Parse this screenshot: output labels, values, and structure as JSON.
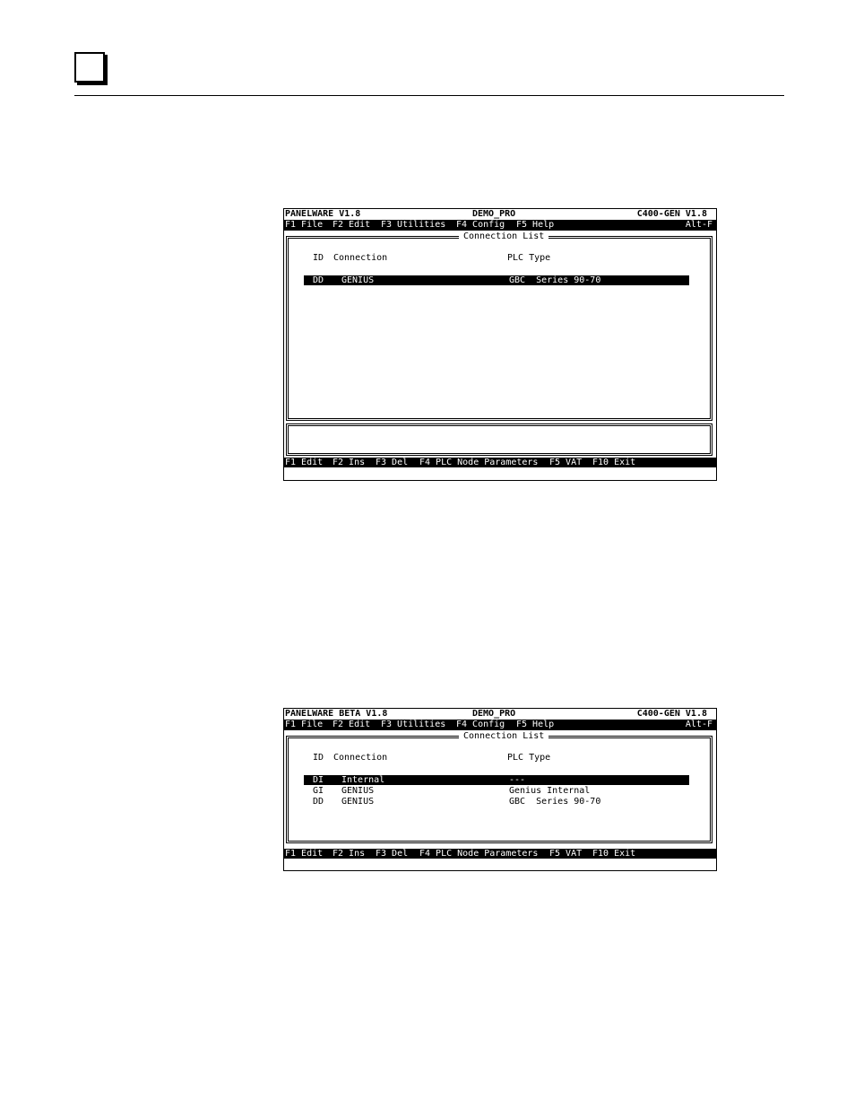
{
  "screens": [
    {
      "app_title": "PANELWARE V1.8",
      "project": "DEMO_PRO",
      "version": "C400-GEN V1.8",
      "menu": [
        "F1 File",
        "F2 Edit",
        "F3 Utilities",
        "F4 Config",
        "F5 Help"
      ],
      "menu_hint": "Alt-F",
      "list_title": "Connection List",
      "columns": {
        "id": "ID",
        "connection": "Connection",
        "plc_type": "PLC Type"
      },
      "rows": [
        {
          "id": "DD",
          "connection": "GENIUS",
          "plc_type": "GBC  Series 90-70",
          "selected": true
        }
      ],
      "function_keys": [
        "F1 Edit",
        "F2 Ins",
        "F3 Del",
        "F4 PLC Node Parameters",
        "F5 VAT",
        "F10 Exit"
      ]
    },
    {
      "app_title": "PANELWARE BETA V1.8",
      "project": "DEMO_PRO",
      "version": "C400-GEN V1.8",
      "menu": [
        "F1 File",
        "F2 Edit",
        "F3 Utilities",
        "F4 Config",
        "F5 Help"
      ],
      "menu_hint": "Alt-F",
      "list_title": "Connection List",
      "columns": {
        "id": "ID",
        "connection": "Connection",
        "plc_type": "PLC Type"
      },
      "rows": [
        {
          "id": "DI",
          "connection": "Internal",
          "plc_type": "---",
          "selected": true
        },
        {
          "id": "GI",
          "connection": "GENIUS",
          "plc_type": "Genius Internal",
          "selected": false
        },
        {
          "id": "DD",
          "connection": "GENIUS",
          "plc_type": "GBC  Series 90-70",
          "selected": false
        }
      ],
      "function_keys": [
        "F1 Edit",
        "F2 Ins",
        "F3 Del",
        "F4 PLC Node Parameters",
        "F5 VAT",
        "F10 Exit"
      ]
    }
  ]
}
